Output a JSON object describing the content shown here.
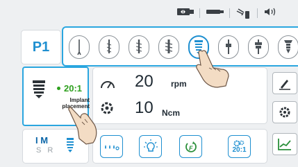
{
  "status_bar": {
    "icons": [
      "motor-icon",
      "handpiece-icon",
      "pump-icon",
      "sound-icon"
    ]
  },
  "program": {
    "label": "P1"
  },
  "steps": [
    {
      "icon": "drill-step-1-icon",
      "active": false
    },
    {
      "icon": "drill-step-2-icon",
      "active": false
    },
    {
      "icon": "drill-step-3-icon",
      "active": false
    },
    {
      "icon": "drill-step-4-icon",
      "active": false
    },
    {
      "icon": "implant-placement-icon",
      "active": true
    },
    {
      "icon": "drill-step-6-icon",
      "active": false
    },
    {
      "icon": "drill-step-7-icon",
      "active": false
    },
    {
      "icon": "drill-step-8-icon",
      "active": false
    }
  ],
  "current_step": {
    "ratio": "20:1",
    "name_line1": "Implant",
    "name_line2": "placement"
  },
  "parameters": {
    "speed_value": "20",
    "speed_unit": "rpm",
    "torque_value": "10",
    "torque_unit": "Ncm"
  },
  "mode": {
    "top": "I M",
    "bottom": "S R"
  },
  "bottom_buttons": {
    "ratio_label": "20:1"
  },
  "colors": {
    "accent": "#2aa6df",
    "ratio_green": "#2ea01e",
    "program_blue": "#1f8fd0"
  }
}
